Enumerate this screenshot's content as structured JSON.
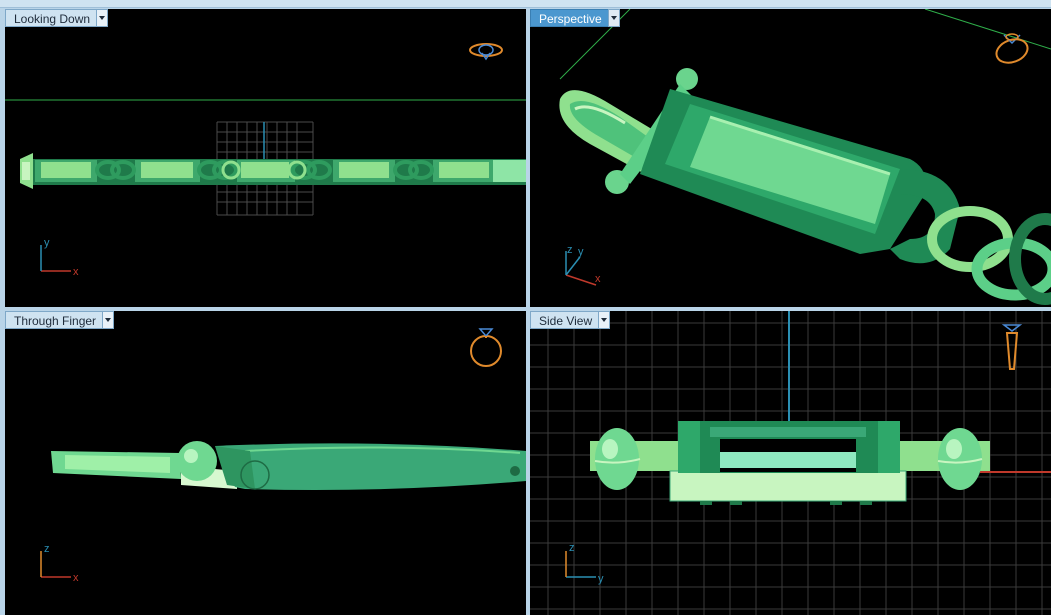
{
  "viewports": [
    {
      "id": "top-left",
      "label": "Looking Down",
      "active": false,
      "axes": [
        "y",
        "x"
      ]
    },
    {
      "id": "top-right",
      "label": "Perspective",
      "active": true,
      "axes": [
        "z",
        "y",
        "x"
      ]
    },
    {
      "id": "bottom-left",
      "label": "Through Finger",
      "active": false,
      "axes": [
        "z",
        "x"
      ]
    },
    {
      "id": "bottom-right",
      "label": "Side View",
      "active": false,
      "axes": [
        "z",
        "y"
      ]
    }
  ],
  "colors": {
    "background": "#000000",
    "model_green": "#3fbf7a",
    "grid": "#3a3a3a",
    "axis_x": "#c0392b",
    "axis_y": "#2b8fb3",
    "axis_z": "#2b8fb3",
    "nav_icon": "#e08a2c"
  },
  "icons": {
    "top-left": "ring-top-view-icon",
    "top-right": "ring-perspective-icon",
    "bottom-left": "ring-front-view-icon",
    "bottom-right": "ring-side-view-icon"
  }
}
